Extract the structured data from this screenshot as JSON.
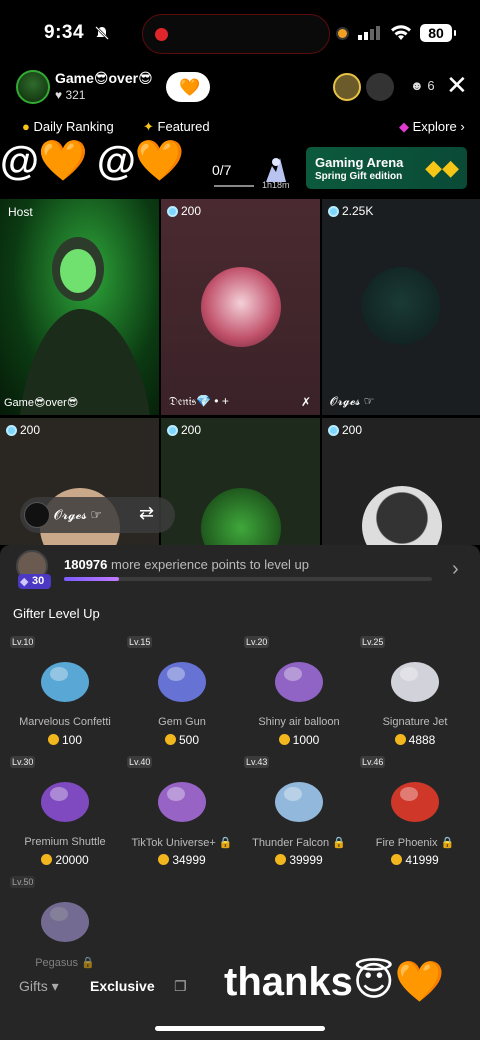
{
  "status_bar": {
    "time": "9:34",
    "battery": "80"
  },
  "host": {
    "name": "Game😎over😎",
    "likes": "♥ 321",
    "follow_icon": "🧡"
  },
  "viewers": "6",
  "nav": {
    "daily_ranking": "Daily Ranking",
    "featured": "Featured",
    "explore": "Explore ›"
  },
  "mentions": "@🧡 @🧡",
  "session": {
    "counter": "0/7",
    "timer": "1h18m"
  },
  "arena": {
    "title": "Gaming Arena",
    "subtitle": "Spring Gift edition"
  },
  "grid": [
    {
      "label": "Host",
      "name": "Game😎over😎"
    },
    {
      "count": "200",
      "name": "𝔇𝔢𝔫𝔦𝔰💎 • +"
    },
    {
      "count": "2.25K",
      "name": "𝓞𝓻𝓰𝓮𝓼 ☞"
    },
    {
      "count": "200"
    },
    {
      "count": "200"
    },
    {
      "count": "200"
    }
  ],
  "user_chip": {
    "name": "𝓞𝓻𝓰𝓮𝓼 ☞",
    "swap_icon": "⇄"
  },
  "experience": {
    "points": "180976",
    "text": "more experience points to level up",
    "level": "30",
    "progress": 0.15
  },
  "gifter_title": "Gifter Level Up",
  "gifts": [
    {
      "level": "Lv.10",
      "name": "Marvelous Confetti",
      "price": "100",
      "icon": "confetti-icon"
    },
    {
      "level": "Lv.15",
      "name": "Gem Gun",
      "price": "500",
      "icon": "gem-gun-icon"
    },
    {
      "level": "Lv.20",
      "name": "Shiny air balloon",
      "price": "1000",
      "icon": "balloon-icon"
    },
    {
      "level": "Lv.25",
      "name": "Signature Jet",
      "price": "4888",
      "icon": "jet-icon"
    },
    {
      "level": "Lv.30",
      "name": "Premium Shuttle",
      "price": "20000",
      "icon": "shuttle-icon"
    },
    {
      "level": "Lv.40",
      "name": "TikTok Universe+ 🔒",
      "price": "34999",
      "icon": "universe-icon"
    },
    {
      "level": "Lv.43",
      "name": "Thunder Falcon 🔒",
      "price": "39999",
      "icon": "falcon-icon"
    },
    {
      "level": "Lv.46",
      "name": "Fire Phoenix 🔒",
      "price": "41999",
      "icon": "phoenix-icon"
    },
    {
      "level": "Lv.50",
      "name": "Pegasus 🔒",
      "price": "",
      "icon": "pegasus-icon"
    }
  ],
  "bottom_tabs": {
    "gifts": "Gifts ▾",
    "exclusive": "Exclusive"
  },
  "overlay_text": "thanks😇🧡",
  "colors": {
    "accent": "#7a5cff",
    "coin": "#f2b71f",
    "panel": "#262626",
    "arena": "#0c5a3e"
  }
}
